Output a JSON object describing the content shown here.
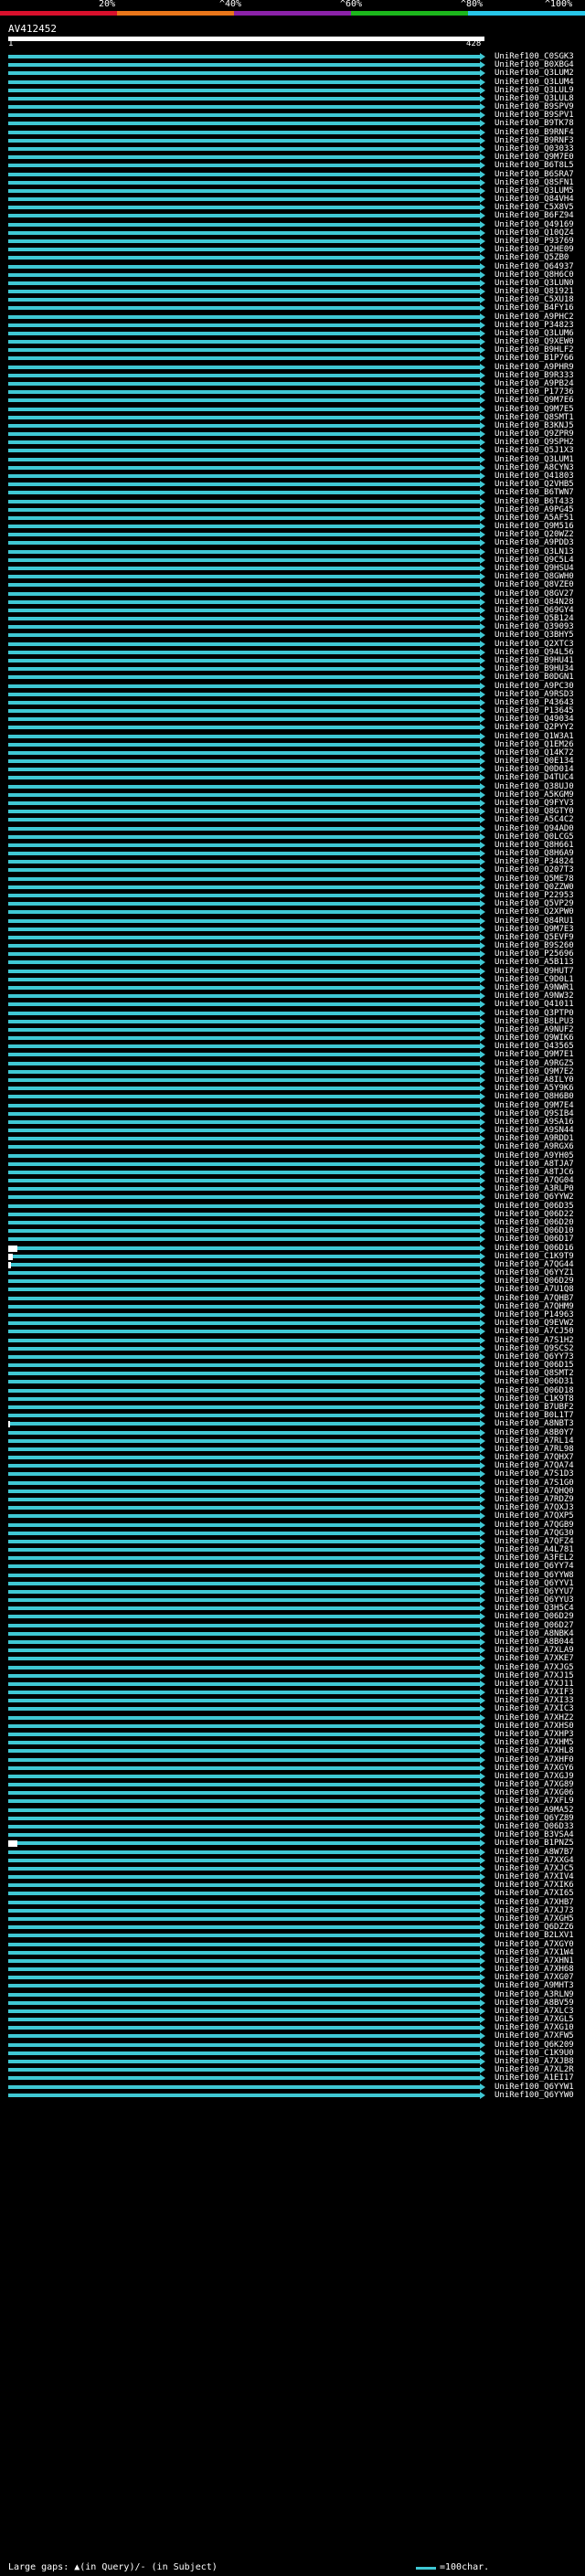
{
  "scale": {
    "labels": [
      "20%",
      "^40%",
      "^60%",
      "^80%",
      "^100%"
    ],
    "colors": [
      "#d8102c",
      "#e9761a",
      "#8b22a8",
      "#1cb61c",
      "#27c6e8"
    ]
  },
  "query": {
    "id": "AV412452",
    "start": "1",
    "end": "428"
  },
  "hit_color": "#3fc8d4",
  "hits": [
    "UniRef100_C0SGK3",
    "UniRef100_B0XBG4",
    "UniRef100_Q3LUM2",
    "UniRef100_Q3LUM4",
    "UniRef100_Q3LUL9",
    "UniRef100_Q3LUL8",
    "UniRef100_B9SPV9",
    "UniRef100_B9SPV1",
    "UniRef100_B9TK78",
    "UniRef100_B9RNF4",
    "UniRef100_B9RNF3",
    "UniRef100_Q03033",
    "UniRef100_Q9M7E0",
    "UniRef100_B6T8L5",
    "UniRef100_B6SRA7",
    "UniRef100_Q8SFN1",
    "UniRef100_Q3LUM5",
    "UniRef100_Q84VH4",
    "UniRef100_C5X8V5",
    "UniRef100_B6FZ94",
    "UniRef100_Q49169",
    "UniRef100_Q10QZ4",
    "UniRef100_P93769",
    "UniRef100_Q2HE09",
    "UniRef100_Q5ZB0",
    "UniRef100_Q64937",
    "UniRef100_Q8H6C0",
    "UniRef100_Q3LUN0",
    "UniRef100_Q81921",
    "UniRef100_C5XU18",
    "UniRef100_B4FY16",
    "UniRef100_A9PHC2",
    "UniRef100_P34823",
    "UniRef100_Q3LUM6",
    "UniRef100_Q9XEW0",
    "UniRef100_B9HLF2",
    "UniRef100_B1P766",
    "UniRef100_A9PHR9",
    "UniRef100_B9R333",
    "UniRef100_A9PB24",
    "UniRef100_P17736",
    "UniRef100_Q9M7E6",
    "UniRef100_Q9M7E5",
    "UniRef100_Q8SMT1",
    "UniRef100_B3KNJ5",
    "UniRef100_Q9ZPR9",
    "UniRef100_Q9SPH2",
    "UniRef100_Q5J1X3",
    "UniRef100_Q3LUM1",
    "UniRef100_A8CYN3",
    "UniRef100_Q41803",
    "UniRef100_Q2VHB5",
    "UniRef100_B6TWN7",
    "UniRef100_B6T433",
    "UniRef100_A9PG45",
    "UniRef100_A5AF51",
    "UniRef100_Q9M516",
    "UniRef100_Q20WZ2",
    "UniRef100_A9PDD3",
    "UniRef100_Q3LN13",
    "UniRef100_Q9C5L4",
    "UniRef100_Q9HSU4",
    "UniRef100_Q8GWH0",
    "UniRef100_Q8VZE0",
    "UniRef100_Q8GV27",
    "UniRef100_Q84N28",
    "UniRef100_Q69GY4",
    "UniRef100_Q5B124",
    "UniRef100_Q39093",
    "UniRef100_Q3BHY5",
    "UniRef100_Q2XTC3",
    "UniRef100_Q94L56",
    "UniRef100_B9HU41",
    "UniRef100_B9HU34",
    "UniRef100_B0DGN1",
    "UniRef100_A9PC30",
    "UniRef100_A9RSD3",
    "UniRef100_P43643",
    "UniRef100_P13645",
    "UniRef100_Q49034",
    "UniRef100_Q2PYY2",
    "UniRef100_Q1W3A1",
    "UniRef100_Q1EM26",
    "UniRef100_Q14K72",
    "UniRef100_Q0E134",
    "UniRef100_Q0D014",
    "UniRef100_D4TUC4",
    "UniRef100_Q38UJ0",
    "UniRef100_A5KGM9",
    "UniRef100_Q9FYV3",
    "UniRef100_Q8GTY0",
    "UniRef100_A5C4C2",
    "UniRef100_Q94AD0",
    "UniRef100_Q0LCG5",
    "UniRef100_Q8H661",
    "UniRef100_Q8H6A9",
    "UniRef100_P34824",
    "UniRef100_Q207T3",
    "UniRef100_Q5ME78",
    "UniRef100_Q0ZZW0",
    "UniRef100_P22953",
    "UniRef100_Q5VP29",
    "UniRef100_Q2XPW0",
    "UniRef100_Q84RU1",
    "UniRef100_Q9M7E3",
    "UniRef100_Q5EVF9",
    "UniRef100_B9S260",
    "UniRef100_P25696",
    "UniRef100_A5B113",
    "UniRef100_Q9HUT7",
    "UniRef100_C9D0L1",
    "UniRef100_A9NWR1",
    "UniRef100_A9NW32",
    "UniRef100_Q41011",
    "UniRef100_Q3PTP0",
    "UniRef100_B8LPU3",
    "UniRef100_A9NUF2",
    "UniRef100_Q9WIK6",
    "UniRef100_Q43565",
    "UniRef100_Q9M7E1",
    "UniRef100_A9RGZ5",
    "UniRef100_Q9M7E2",
    "UniRef100_A8ILY0",
    "UniRef100_A5Y9K6",
    "UniRef100_Q8H6B0",
    "UniRef100_Q9M7E4",
    "UniRef100_Q9SIB4",
    "UniRef100_A9SA16",
    "UniRef100_A9SN44",
    "UniRef100_A9RDD1",
    "UniRef100_A9RGX6",
    "UniRef100_A9YH05",
    "UniRef100_A8TJA7",
    "UniRef100_A8TJC6",
    "UniRef100_A7QG04",
    "UniRef100_A3RLP0",
    "UniRef100_Q6YYW2",
    "UniRef100_Q06D35",
    "UniRef100_Q06D22",
    "UniRef100_Q06D20",
    "UniRef100_Q06D10",
    "UniRef100_Q06D17",
    "UniRef100_Q06D16",
    "UniRef100_C1K9T9",
    "UniRef100_A7QG44",
    "UniRef100_Q6YYZ1",
    "UniRef100_Q06D29",
    "UniRef100_A7U1Q8",
    "UniRef100_A7QHB7",
    "UniRef100_A7QHM9",
    "UniRef100_P14963",
    "UniRef100_Q9EVW2",
    "UniRef100_A7CJ50",
    "UniRef100_A7S1H2",
    "UniRef100_Q9SCS2",
    "UniRef100_Q6YY73",
    "UniRef100_Q06D15",
    "UniRef100_Q8SMT2",
    "UniRef100_Q06D31",
    "UniRef100_Q06D18",
    "UniRef100_C1K9T8",
    "UniRef100_B7UBF2",
    "UniRef100_B0L1T7",
    "UniRef100_A8NBT3",
    "UniRef100_A8B0Y7",
    "UniRef100_A7RL14",
    "UniRef100_A7RL98",
    "UniRef100_A7QHX7",
    "UniRef100_A7QA74",
    "UniRef100_A7S1D3",
    "UniRef100_A7S1G0",
    "UniRef100_A7QHQ0",
    "UniRef100_A7RDZ9",
    "UniRef100_A7QXJ3",
    "UniRef100_A7QXP5",
    "UniRef100_A7QGB9",
    "UniRef100_A7QG30",
    "UniRef100_A7QFZ4",
    "UniRef100_A4L781",
    "UniRef100_A3FEL2",
    "UniRef100_Q6YY74",
    "UniRef100_Q6YYW8",
    "UniRef100_Q6YYV1",
    "UniRef100_Q6YYU7",
    "UniRef100_Q6YYU3",
    "UniRef100_Q3H5C4",
    "UniRef100_Q06D29",
    "UniRef100_Q06D27",
    "UniRef100_A8NBK4",
    "UniRef100_A8B044",
    "UniRef100_A7XLA9",
    "UniRef100_A7XKE7",
    "UniRef100_A7XJG5",
    "UniRef100_A7XJ15",
    "UniRef100_A7XJ11",
    "UniRef100_A7XIF3",
    "UniRef100_A7XI33",
    "UniRef100_A7XIC3",
    "UniRef100_A7XHZ2",
    "UniRef100_A7XHS0",
    "UniRef100_A7XHP3",
    "UniRef100_A7XHM5",
    "UniRef100_A7XHL8",
    "UniRef100_A7XHF0",
    "UniRef100_A7XGY6",
    "UniRef100_A7XGJ9",
    "UniRef100_A7XG89",
    "UniRef100_A7XG06",
    "UniRef100_A7XFL9",
    "UniRef100_A9MA52",
    "UniRef100_Q6YZ89",
    "UniRef100_Q06D33",
    "UniRef100_B3VSA4",
    "UniRef100_B1PNZ5",
    "UniRef100_A8W7B7",
    "UniRef100_A7XXG4",
    "UniRef100_A7XJC5",
    "UniRef100_A7XIV4",
    "UniRef100_A7XIK6",
    "UniRef100_A7XI65",
    "UniRef100_A7XHB7",
    "UniRef100_A7XJ73",
    "UniRef100_A7XGH5",
    "UniRef100_Q6DZZ6",
    "UniRef100_B2LXV1",
    "UniRef100_A7XGY0",
    "UniRef100_A7X1W4",
    "UniRef100_A7XHN1",
    "UniRef100_A7XH68",
    "UniRef100_A7XG07",
    "UniRef100_A9MHT3",
    "UniRef100_A3RLN9",
    "UniRef100_A8BV59",
    "UniRef100_A7XLC3",
    "UniRef100_A7XGL5",
    "UniRef100_A7XG10",
    "UniRef100_A7XFW5",
    "UniRef100_Q6K209",
    "UniRef100_C1K9U0",
    "UniRef100_A7XJB8",
    "UniRef100_A7XL2R",
    "UniRef100_A1EI17",
    "UniRef100_Q6YYW1",
    "UniRef100_Q6YYW0"
  ],
  "gaps": [
    {
      "row": 142,
      "width": 10
    },
    {
      "row": 143,
      "width": 5
    },
    {
      "row": 144,
      "width": 3
    },
    {
      "row": 163,
      "width": 2
    },
    {
      "row": 213,
      "width": 10
    },
    {
      "row": 322,
      "width": 11
    }
  ],
  "footer": {
    "large_gaps": "Large gaps: ▲(in Query)/- (in Subject)",
    "legend": "=100char."
  }
}
